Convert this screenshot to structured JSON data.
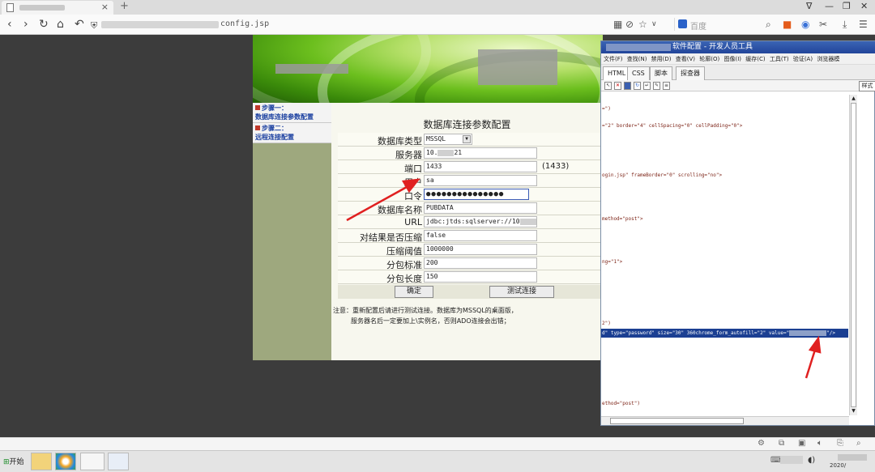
{
  "browser": {
    "tab_close": "×",
    "new_tab": "+",
    "address_suffix": "config.jsp",
    "search_placeholder": "百度",
    "window_controls": [
      "∇",
      "—",
      "❐",
      "✕"
    ]
  },
  "app": {
    "nav": [
      {
        "line1": "步骤一：",
        "line2": "数据库连接参数配置"
      },
      {
        "line1": "步骤二：",
        "line2": "远程连接配置"
      }
    ],
    "form_title": "数据库连接参数配置",
    "fields": {
      "db_type": {
        "label": "数据库类型",
        "value": "MSSQL"
      },
      "server": {
        "label": "服务器",
        "value_prefix": "10.",
        "value_suffix": "21"
      },
      "port": {
        "label": "端口",
        "value": "1433",
        "hint": "(1433)"
      },
      "user": {
        "label": "用户",
        "value": "sa"
      },
      "password": {
        "label": "口令",
        "value": "●●●●●●●●●●●●●●●"
      },
      "db_name": {
        "label": "数据库名称",
        "value": "PUBDATA"
      },
      "url": {
        "label": "URL",
        "value": "jdbc:jtds:sqlserver://10"
      },
      "compress": {
        "label": "对结果是否压缩",
        "value": "false"
      },
      "compress_threshold": {
        "label": "压缩阈值",
        "value": "1000000"
      },
      "packet_standard": {
        "label": "分包标准",
        "value": "200"
      },
      "packet_length": {
        "label": "分包长度",
        "value": "150"
      }
    },
    "buttons": {
      "ok": "确定",
      "test": "测试连接"
    },
    "notes": [
      "注意：重新配置后请进行测试连接。数据库为MSSQL的桌面版，",
      "服务器名后一定要加上\\实例名，否则ADO连接会出错；"
    ]
  },
  "devtools": {
    "title": "软件配置 - 开发人员工具",
    "menu": [
      "文件(F)",
      "查找(N)",
      "禁用(D)",
      "查看(V)",
      "轮廓(O)",
      "图像(I)",
      "缓存(C)",
      "工具(T)",
      "验证(A)",
      "浏览器模"
    ],
    "tabs": [
      "HTML",
      "CSS",
      "脚本",
      "探查器"
    ],
    "side_tab": "样式",
    "code_lines": [
      "=\")",
      "=\"2\" border=\"4\" cellSpacing=\"0\" cellPadding=\"0\">",
      "ogin.jsp\" frameBorder=\"0\" scrolling=\"no\">",
      "method=\"post\">",
      "ng=\"1\">",
      "2\")",
      "d\" type=\"password\" size=\"30\" 360chrome_form_autofill=\"2\" value=\"",
      "\"/>",
      "ethod=\"post\")"
    ]
  },
  "taskbar": {
    "start": "开始",
    "clock": "2020/"
  },
  "colors": {
    "annotation_arrow": "#e02020",
    "devtools_highlight": "#1b3f92",
    "app_nav_bg": "#9ea87e"
  }
}
